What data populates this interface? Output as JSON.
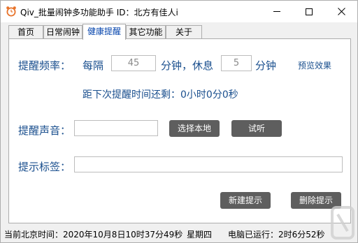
{
  "window": {
    "title": "Qiv_批量闹钟多功能助手 ID：北方有佳人i",
    "icon": "alarm-clock-icon"
  },
  "tabs": [
    {
      "label": "首页",
      "active": false
    },
    {
      "label": "日常闹钟",
      "active": false
    },
    {
      "label": "健康提醒",
      "active": true
    },
    {
      "label": "其它功能",
      "active": false
    },
    {
      "label": "关于",
      "active": false
    }
  ],
  "reminder": {
    "frequency_label": "提醒频率：",
    "every_label": "每隔",
    "interval_value": "45",
    "minutes_rest_label": "分钟，休息",
    "rest_value": "5",
    "minutes_label": "分钟",
    "preview_link": "预览效果",
    "countdown_text": "距下次提醒时间还剩：0小时0分0秒",
    "sound_label": "提醒声音：",
    "sound_value": "",
    "choose_local_button": "选择本地",
    "listen_button": "试听",
    "tag_label": "提示标签：",
    "tag_value": "",
    "new_button": "新建提示",
    "delete_button": "删除提示"
  },
  "status": {
    "beijing_time": "当前北京时间：2020年10月8日10时37分49秒",
    "weekday": "星期四",
    "uptime": "电脑已运行：2时6分52秒"
  },
  "colors": {
    "label_blue": "#1a4f8e",
    "button_gray": "#5e5e5e",
    "active_tab_text": "#0645ad"
  }
}
